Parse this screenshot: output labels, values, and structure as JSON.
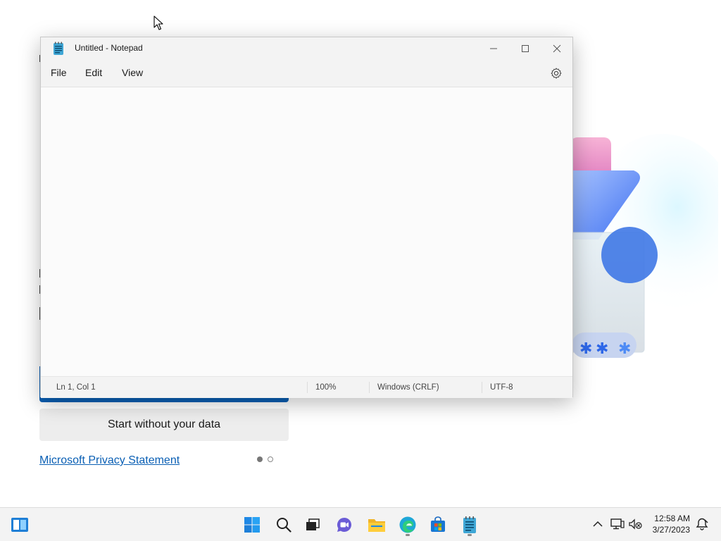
{
  "background_app": {
    "secondary_button_label": "Start without your data",
    "privacy_link": "Microsoft Privacy Statement",
    "pager": {
      "current": 1,
      "total": 2
    }
  },
  "notepad": {
    "title": "Untitled - Notepad",
    "menu": [
      "File",
      "Edit",
      "View"
    ],
    "editor_text": "",
    "status": {
      "position": "Ln 1, Col 1",
      "zoom": "100%",
      "line_ending": "Windows (CRLF)",
      "encoding": "UTF-8"
    }
  },
  "taskbar": {
    "pinned": [
      "start-icon",
      "search-icon",
      "task-view-icon",
      "chat-icon",
      "file-explorer-icon",
      "edge-icon",
      "store-icon",
      "notepad-icon"
    ],
    "clock": {
      "time": "12:58 AM",
      "date": "3/27/2023"
    }
  },
  "colors": {
    "accent": "#0a5fb4",
    "window_bg": "#fbfbfb",
    "chrome_bg": "#f3f3f3"
  }
}
